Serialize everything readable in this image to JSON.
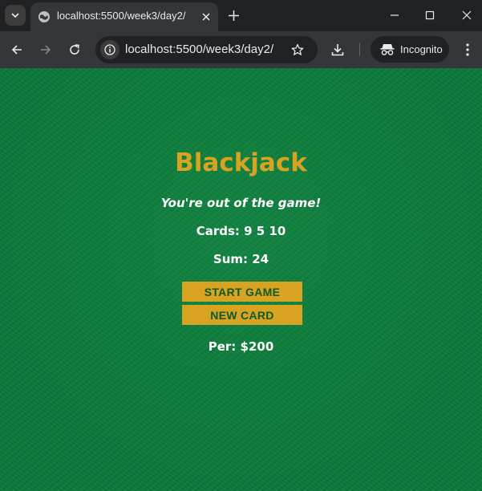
{
  "browser": {
    "tab_title": "localhost:5500/week3/day2/",
    "url": "localhost:5500/week3/day2/",
    "incognito_label": "Incognito",
    "icons": [
      "tab-search-icon",
      "globe-icon",
      "close-icon",
      "plus-icon",
      "minimize-icon",
      "maximize-icon",
      "window-close-icon",
      "back-arrow-icon",
      "forward-arrow-icon",
      "reload-icon",
      "site-info-icon",
      "star-icon",
      "download-icon",
      "incognito-icon",
      "kebab-menu-icon"
    ]
  },
  "game": {
    "title": "Blackjack",
    "message": "You're out of the game!",
    "cards_text": "Cards: 9 5 10",
    "sum_text": "Sum: 24",
    "start_button": "START GAME",
    "new_card_button": "NEW CARD",
    "player_text": "Per: $200"
  },
  "colors": {
    "felt_green": "#0b7a3a",
    "gold": "#d8a320",
    "button_text": "#0b5a28"
  }
}
